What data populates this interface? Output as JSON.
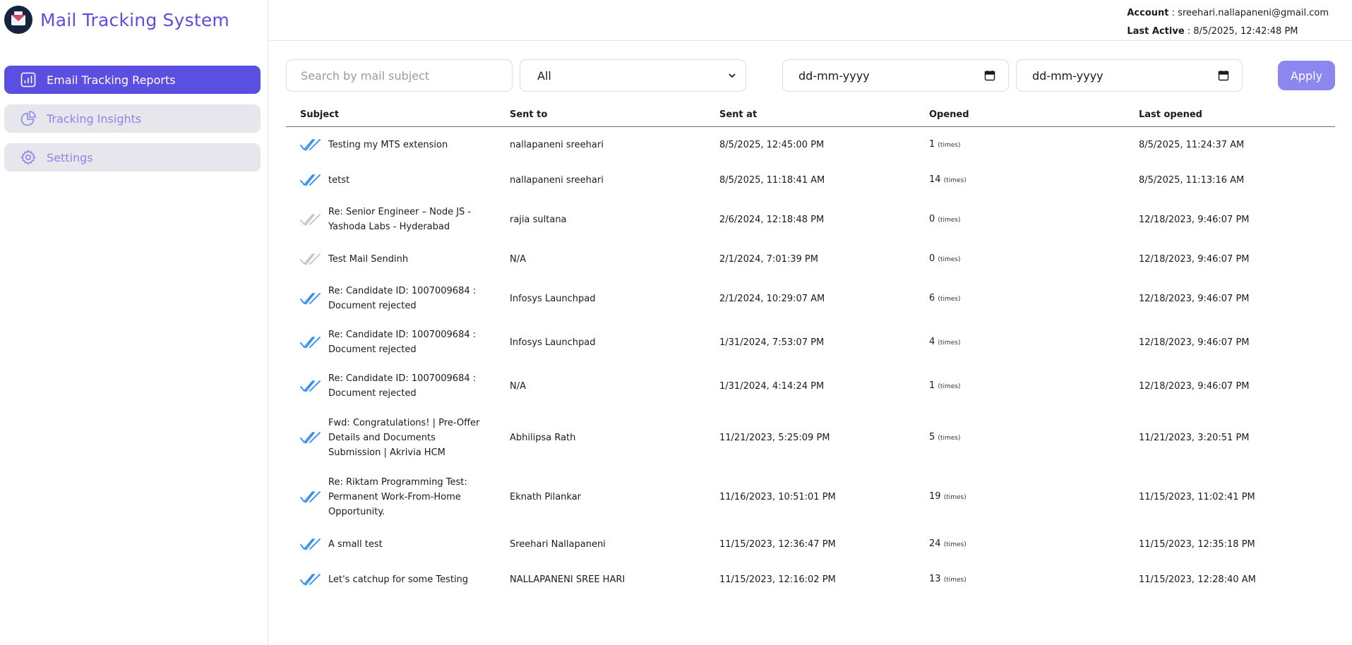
{
  "app": {
    "title": "Mail Tracking System"
  },
  "sidebar": {
    "items": [
      {
        "label": "Email Tracking Reports",
        "active": true
      },
      {
        "label": "Tracking Insights",
        "active": false
      },
      {
        "label": "Settings",
        "active": false
      }
    ]
  },
  "header": {
    "account_label": "Account",
    "account_value": "sreehari.nallapaneni@gmail.com",
    "last_active_label": "Last Active",
    "last_active_value": "8/5/2025, 12:42:48 PM"
  },
  "filters": {
    "search_placeholder": "Search by mail subject",
    "status_selected": "All",
    "date_from_placeholder": "dd-mm-yyyy",
    "date_to_placeholder": "dd-mm-yyyy",
    "apply_label": "Apply"
  },
  "colors": {
    "accent": "#5a4fe0",
    "opened_tick": "#2f8cf0",
    "unopened_tick": "#c4c4c4"
  },
  "table": {
    "columns": [
      "Subject",
      "Sent to",
      "Sent at",
      "Opened",
      "Last opened"
    ],
    "times_label": "(times)",
    "rows": [
      {
        "subject": "Testing my MTS extension",
        "sent_to": "nallapaneni sreehari",
        "sent_at": "8/5/2025, 12:45:00 PM",
        "opened": "1",
        "last_opened": "8/5/2025, 11:24:37 AM",
        "read": true
      },
      {
        "subject": "tetst",
        "sent_to": "nallapaneni sreehari",
        "sent_at": "8/5/2025, 11:18:41 AM",
        "opened": "14",
        "last_opened": "8/5/2025, 11:13:16 AM",
        "read": true
      },
      {
        "subject": "Re: Senior Engineer – Node JS - Yashoda Labs - Hyderabad",
        "sent_to": "rajia sultana",
        "sent_at": "2/6/2024, 12:18:48 PM",
        "opened": "0",
        "last_opened": "12/18/2023, 9:46:07 PM",
        "read": false
      },
      {
        "subject": "Test Mail Sendinh",
        "sent_to": "N/A",
        "sent_at": "2/1/2024, 7:01:39 PM",
        "opened": "0",
        "last_opened": "12/18/2023, 9:46:07 PM",
        "read": false
      },
      {
        "subject": "Re: Candidate ID: 1007009684 : Document rejected",
        "sent_to": "Infosys Launchpad",
        "sent_at": "2/1/2024, 10:29:07 AM",
        "opened": "6",
        "last_opened": "12/18/2023, 9:46:07 PM",
        "read": true
      },
      {
        "subject": "Re: Candidate ID: 1007009684 : Document rejected",
        "sent_to": "Infosys Launchpad",
        "sent_at": "1/31/2024, 7:53:07 PM",
        "opened": "4",
        "last_opened": "12/18/2023, 9:46:07 PM",
        "read": true
      },
      {
        "subject": "Re: Candidate ID: 1007009684 : Document rejected",
        "sent_to": "N/A",
        "sent_at": "1/31/2024, 4:14:24 PM",
        "opened": "1",
        "last_opened": "12/18/2023, 9:46:07 PM",
        "read": true
      },
      {
        "subject": "Fwd: Congratulations! | Pre-Offer Details and Documents Submission | Akrivia HCM",
        "sent_to": "Abhilipsa Rath",
        "sent_at": "11/21/2023, 5:25:09 PM",
        "opened": "5",
        "last_opened": "11/21/2023, 3:20:51 PM",
        "read": true
      },
      {
        "subject": "Re: Riktam Programming Test: Permanent Work-From-Home Opportunity.",
        "sent_to": "Eknath Pilankar",
        "sent_at": "11/16/2023, 10:51:01 PM",
        "opened": "19",
        "last_opened": "11/15/2023, 11:02:41 PM",
        "read": true
      },
      {
        "subject": "A small test",
        "sent_to": "Sreehari Nallapaneni",
        "sent_at": "11/15/2023, 12:36:47 PM",
        "opened": "24",
        "last_opened": "11/15/2023, 12:35:18 PM",
        "read": true
      },
      {
        "subject": "Let's catchup for some Testing",
        "sent_to": "NALLAPANENI SREE HARI",
        "sent_at": "11/15/2023, 12:16:02 PM",
        "opened": "13",
        "last_opened": "11/15/2023, 12:28:40 AM",
        "read": true
      }
    ]
  }
}
